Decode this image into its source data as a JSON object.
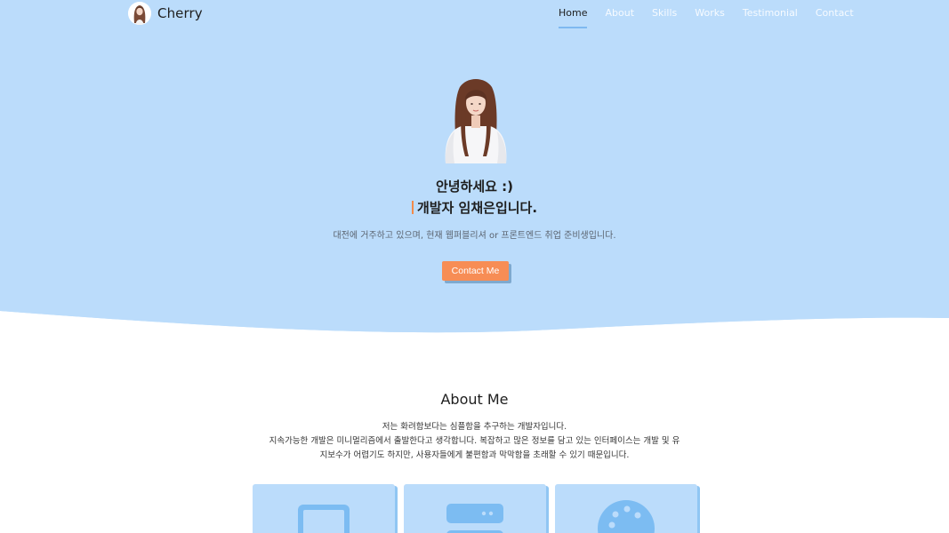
{
  "nav": {
    "brand": "Cherry",
    "items": [
      {
        "label": "Home",
        "active": true
      },
      {
        "label": "About",
        "active": false
      },
      {
        "label": "Skills",
        "active": false
      },
      {
        "label": "Works",
        "active": false
      },
      {
        "label": "Testimonial",
        "active": false
      },
      {
        "label": "Contact",
        "active": false
      }
    ]
  },
  "hero": {
    "greeting": "안녕하세요 :)",
    "role": "개발자 임채은입니다.",
    "intro": "대전에 거주하고 있으며, 현재 웹퍼블리셔 or 프론트엔드 취업 준비생입니다.",
    "cta_label": "Contact Me"
  },
  "about": {
    "title": "About Me",
    "lines": [
      "저는 화려함보다는 심플함을 추구하는 개발자입니다.",
      "지속가능한 개발은 미니멀리즘에서 출발한다고 생각합니다. 복잡하고 많은 정보를 담고 있는 인터페이스는 개발 및 유",
      "지보수가 어렵기도 하지만, 사용자들에게 불편함과 막막함을 초래할 수 있기 때문입니다."
    ],
    "cards": [
      {
        "icon": "tablet-icon"
      },
      {
        "icon": "server-icon"
      },
      {
        "icon": "palette-icon"
      }
    ]
  },
  "colors": {
    "hero_bg": "#bbdcfb",
    "accent": "#f78d55",
    "card_bg": "#bbdcfb",
    "icon": "#7cbcf2"
  }
}
